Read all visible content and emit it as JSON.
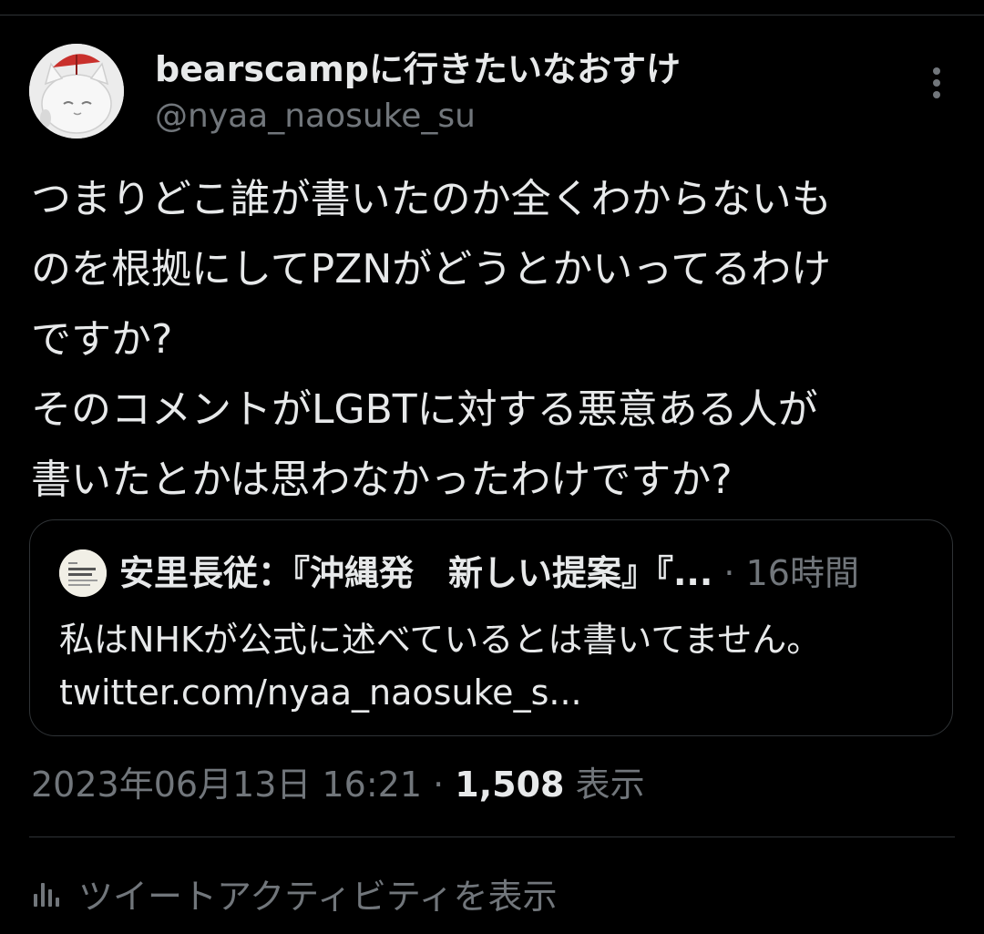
{
  "tweet": {
    "display_name": "bearscampに行きたいなおすけ",
    "handle": "@nyaa_naosuke_su",
    "text": "つまりどこ誰が書いたのか全くわからないも\nのを根拠にしてPZNがどうとかいってるわけ\nですか?\nそのコメントがLGBTに対する悪意ある人が\n書いたとかは思わなかったわけですか?",
    "timestamp": "2023年06月13日 16:21",
    "separator": "·",
    "views_count": "1,508",
    "views_label": "表示"
  },
  "quote": {
    "author": "安里長従：『沖縄発　新しい提案』『...",
    "separator": "·",
    "time": "16時間",
    "text": "私はNHKが公式に述べているとは書いてません。\ntwitter.com/nyaa_naosuke_s..."
  },
  "activity": {
    "label": "ツイートアクティビティを表示",
    "icon": "analytics-bar-icon"
  },
  "icons": {
    "more": "more-vertical-icon",
    "avatar": "avatar-cat-umbrella",
    "quote_avatar": "avatar-document-thumbnail"
  },
  "colors": {
    "background": "#000000",
    "text_primary": "#e7e9ea",
    "text_secondary": "#71767b",
    "divider": "#2f3336"
  }
}
